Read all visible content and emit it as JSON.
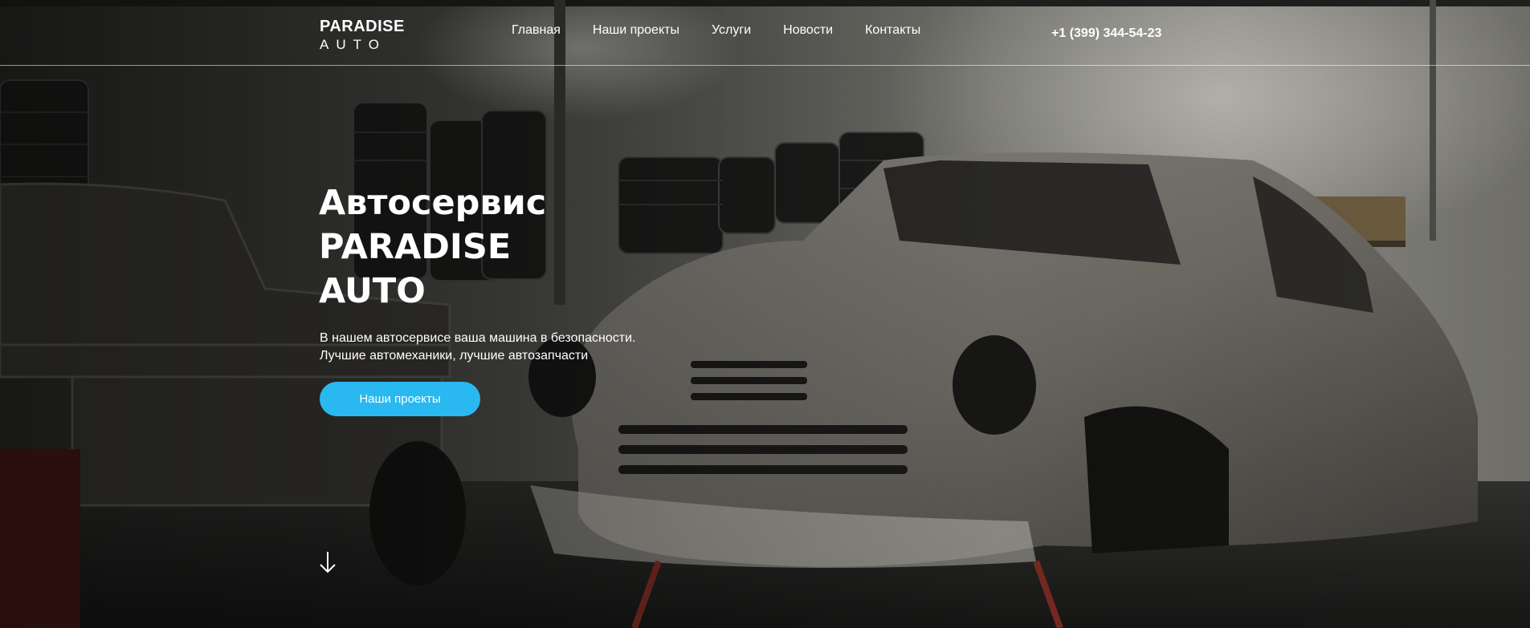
{
  "header": {
    "logo_top": "PARADISE",
    "logo_bottom": "AUTO",
    "nav": [
      {
        "label": "Главная"
      },
      {
        "label": "Наши проекты"
      },
      {
        "label": "Услуги"
      },
      {
        "label": "Новости"
      },
      {
        "label": "Контакты"
      }
    ],
    "phone": "+1 (399) 344-54-23"
  },
  "hero": {
    "title_lines": [
      "Автосервис",
      "PARADISE",
      "AUTO"
    ],
    "description_lines": [
      "В нашем автосервисе ваша машина в безопасности.",
      "Лучшие автомеханики, лучшие автозапчасти"
    ],
    "cta_label": "Наши проекты",
    "scroll_icon": "arrow-down-icon"
  },
  "colors": {
    "accent": "#2ab8f0",
    "text": "#ffffff"
  }
}
